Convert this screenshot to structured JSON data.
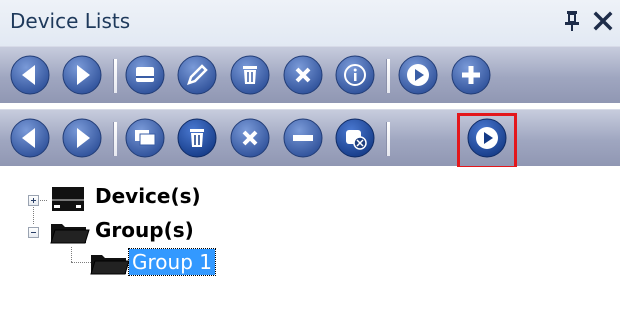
{
  "panel": {
    "title": "Device Lists",
    "pin_icon": "pin-icon",
    "close_icon": "close-icon"
  },
  "toolbar1": {
    "buttons": [
      "back-icon",
      "forward-icon",
      "device-icon",
      "edit-icon",
      "delete-icon",
      "cancel-icon",
      "info-icon",
      "play-icon",
      "add-icon"
    ]
  },
  "toolbar2": {
    "buttons": [
      "back-icon",
      "forward-icon",
      "monitor-icon",
      "delete-icon",
      "cancel-icon",
      "minus-icon",
      "remove-user-icon",
      "play-icon"
    ],
    "highlighted_button": "play-icon"
  },
  "tree": {
    "nodes": [
      {
        "label": "Device(s)",
        "icon": "device-icon",
        "expanded": false
      },
      {
        "label": "Group(s)",
        "icon": "folder-icon",
        "expanded": true,
        "children": [
          {
            "label": "Group 1",
            "icon": "folder-icon",
            "selected": true
          }
        ]
      }
    ]
  },
  "colors": {
    "toolbar": "#9fa6c0",
    "button": "#3a5ea6",
    "selection": "#3399ff",
    "highlight_border": "#e3171c"
  }
}
